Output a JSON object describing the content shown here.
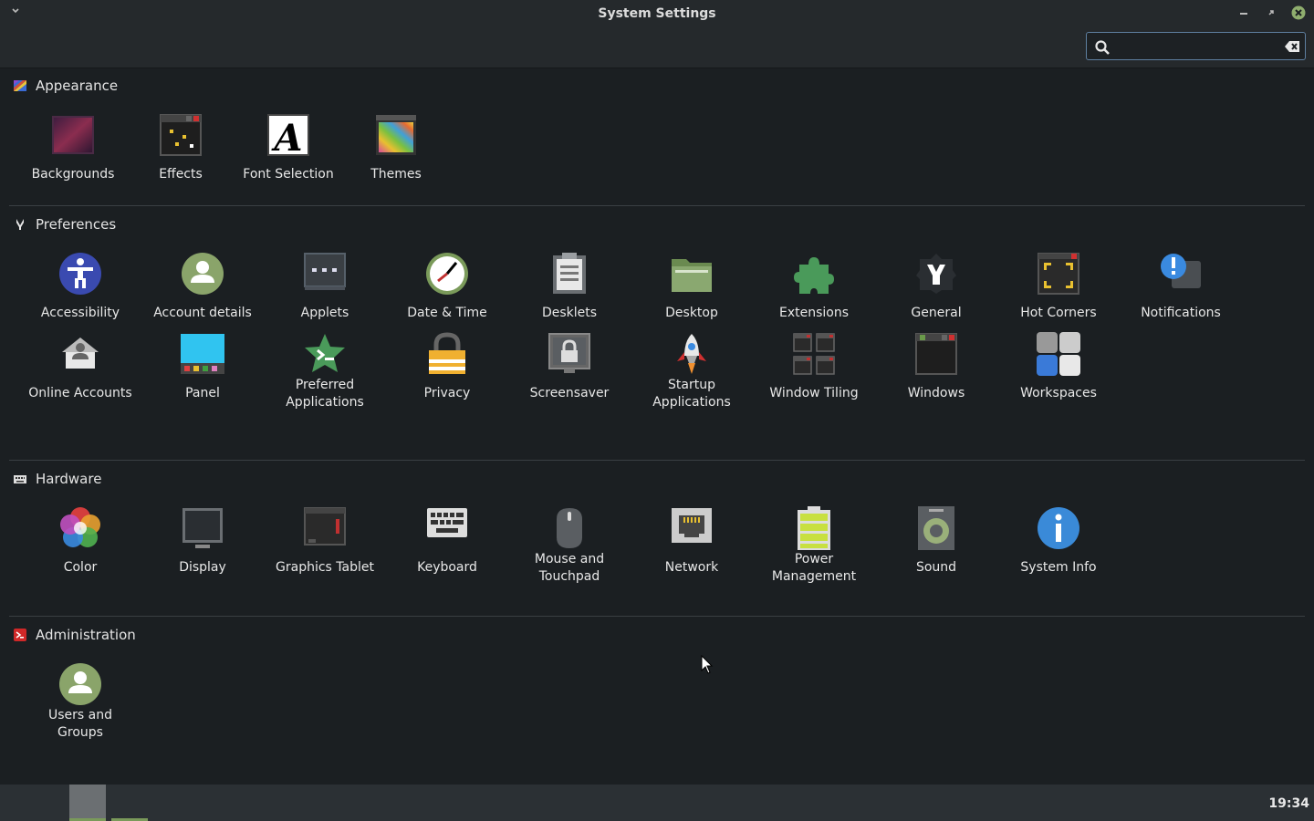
{
  "window": {
    "title": "System Settings",
    "search_value": "",
    "search_placeholder": ""
  },
  "sections": {
    "appearance": {
      "title": "Appearance",
      "items": [
        "Backgrounds",
        "Effects",
        "Font Selection",
        "Themes"
      ]
    },
    "preferences": {
      "title": "Preferences",
      "items": [
        "Accessibility",
        "Account details",
        "Applets",
        "Date & Time",
        "Desklets",
        "Desktop",
        "Extensions",
        "General",
        "Hot Corners",
        "Notifications",
        "Online Accounts",
        "Panel",
        "Preferred\nApplications",
        "Privacy",
        "Screensaver",
        "Startup\nApplications",
        "Window Tiling",
        "Windows",
        "Workspaces"
      ]
    },
    "hardware": {
      "title": "Hardware",
      "items": [
        "Color",
        "Display",
        "Graphics Tablet",
        "Keyboard",
        "Mouse and\nTouchpad",
        "Network",
        "Power\nManagement",
        "Sound",
        "System Info"
      ]
    },
    "administration": {
      "title": "Administration",
      "items": [
        "Users and\nGroups"
      ]
    }
  },
  "taskbar": {
    "clock": "19:34"
  },
  "colors": {
    "background": "#1b1f22",
    "titlebar": "#25292c",
    "accent_green": "#7a9a5a",
    "close_button": "#8fae6e"
  }
}
